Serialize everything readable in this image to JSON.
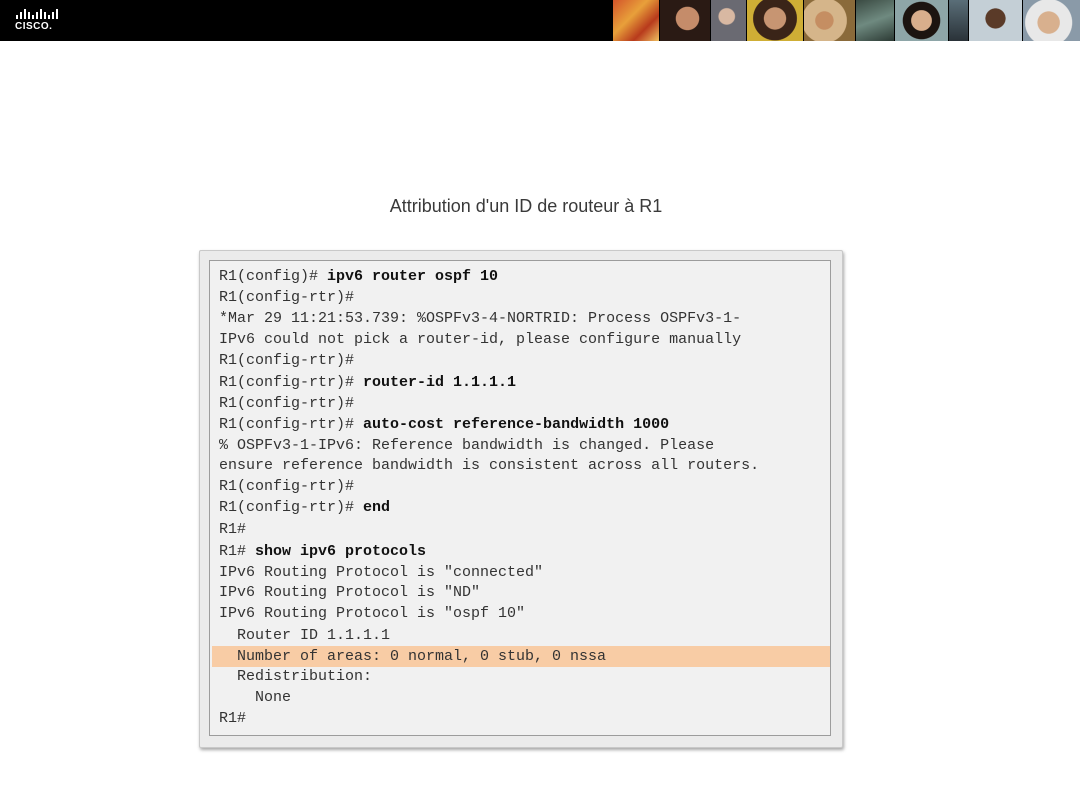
{
  "header": {
    "logo_text": "CISCO.",
    "photo_count": 10
  },
  "slide": {
    "title": "Attribution d'un ID de routeur à R1"
  },
  "colors": {
    "header_bg": "#000000",
    "highlight": "#f8cca5",
    "console_bg": "#f1f1f1"
  },
  "console": {
    "lines": [
      {
        "prompt": "R1(config)# ",
        "cmd": "ipv6 router ospf 10"
      },
      {
        "prompt": "R1(config-rtr)#",
        "cmd": ""
      },
      {
        "prompt": "*Mar 29 11:21:53.739: %OSPFv3-4-NORTRID: Process OSPFv3-1-",
        "cmd": ""
      },
      {
        "prompt": "IPv6 could not pick a router-id, please configure manually",
        "cmd": ""
      },
      {
        "prompt": "R1(config-rtr)#",
        "cmd": ""
      },
      {
        "prompt": "R1(config-rtr)# ",
        "cmd": "router-id 1.1.1.1"
      },
      {
        "prompt": "R1(config-rtr)#",
        "cmd": ""
      },
      {
        "prompt": "R1(config-rtr)# ",
        "cmd": "auto-cost reference-bandwidth 1000"
      },
      {
        "prompt": "% OSPFv3-1-IPv6: Reference bandwidth is changed. Please",
        "cmd": ""
      },
      {
        "prompt": "ensure reference bandwidth is consistent across all routers.",
        "cmd": ""
      },
      {
        "prompt": "R1(config-rtr)#",
        "cmd": ""
      },
      {
        "prompt": "R1(config-rtr)# ",
        "cmd": "end"
      },
      {
        "prompt": "R1#",
        "cmd": ""
      },
      {
        "prompt": "R1# ",
        "cmd": "show ipv6 protocols"
      },
      {
        "prompt": "IPv6 Routing Protocol is \"connected\"",
        "cmd": ""
      },
      {
        "prompt": "IPv6 Routing Protocol is \"ND\"",
        "cmd": ""
      },
      {
        "prompt": "IPv6 Routing Protocol is \"ospf 10\"",
        "cmd": ""
      },
      {
        "prompt": "  Router ID 1.1.1.1",
        "cmd": ""
      },
      {
        "prompt": "  Number of areas: 0 normal, 0 stub, 0 nssa",
        "cmd": "",
        "highlighted": true
      },
      {
        "prompt": "  Redistribution:",
        "cmd": ""
      },
      {
        "prompt": "    None",
        "cmd": ""
      },
      {
        "prompt": "R1#",
        "cmd": ""
      }
    ]
  }
}
